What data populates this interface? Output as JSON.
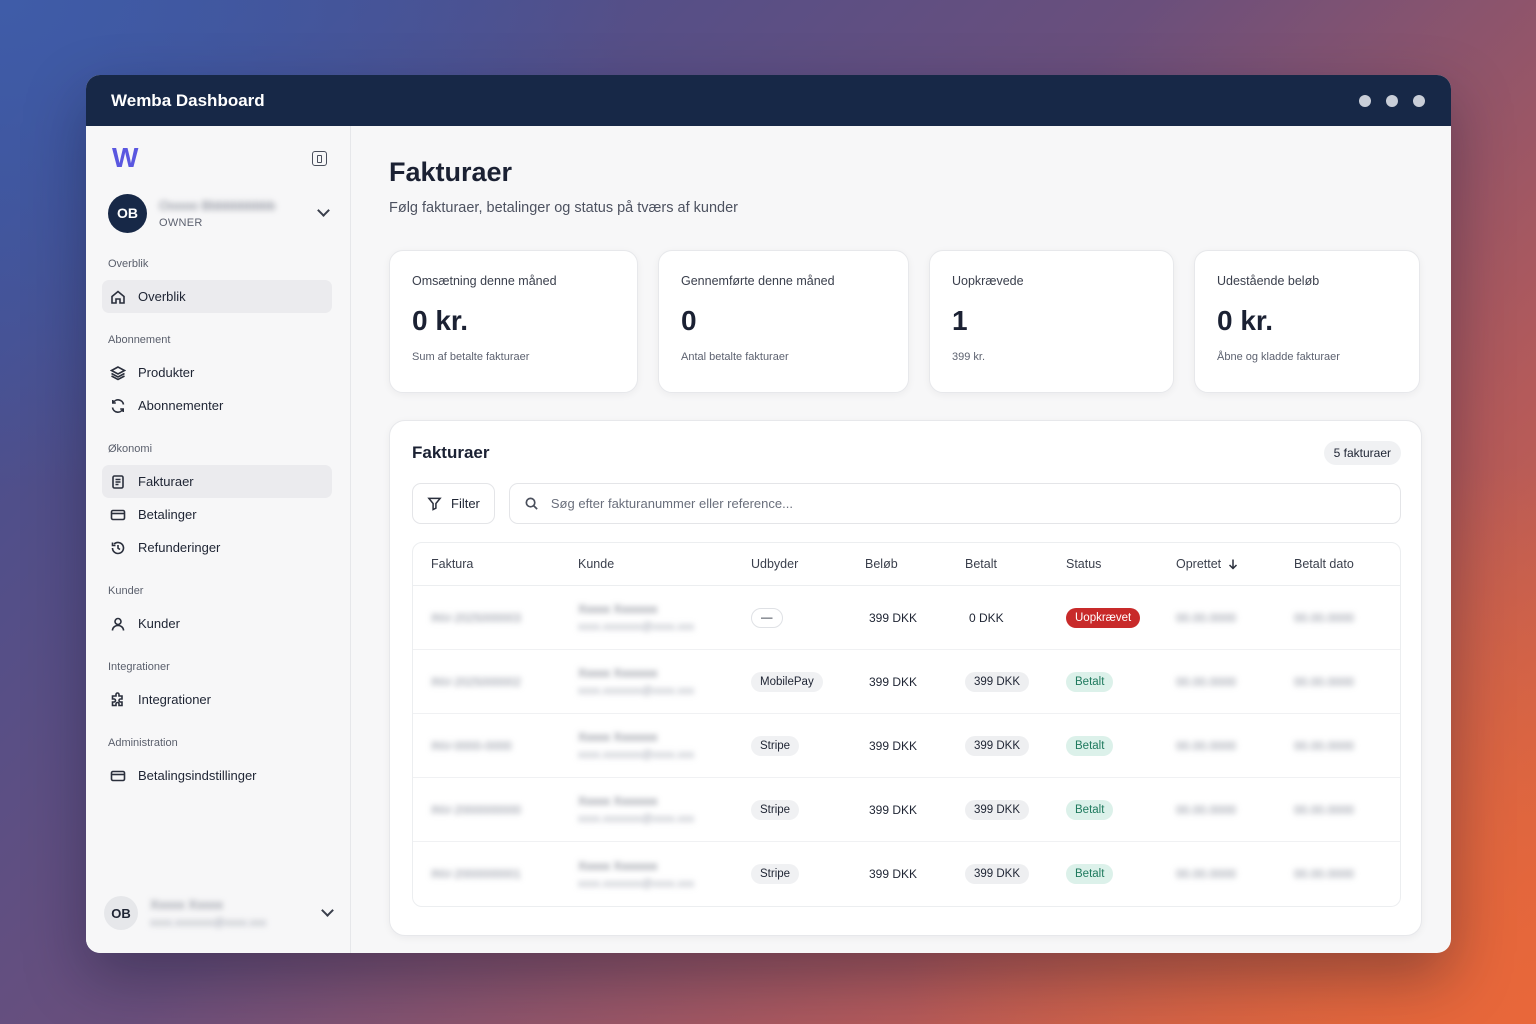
{
  "window": {
    "title": "Wemba Dashboard"
  },
  "sidebar": {
    "logo": "W",
    "user": {
      "initials": "OB",
      "name": "Ooooo Bbbbbbbbbb",
      "role": "OWNER"
    },
    "groups": [
      {
        "label": "Overblik",
        "items": [
          {
            "label": "Overblik",
            "icon": "home-icon"
          }
        ]
      },
      {
        "label": "Abonnement",
        "items": [
          {
            "label": "Produkter",
            "icon": "layers-icon"
          },
          {
            "label": "Abonnementer",
            "icon": "refresh-icon"
          }
        ]
      },
      {
        "label": "Økonomi",
        "items": [
          {
            "label": "Fakturaer",
            "icon": "invoice-icon"
          },
          {
            "label": "Betalinger",
            "icon": "card-icon"
          },
          {
            "label": "Refunderinger",
            "icon": "history-icon"
          }
        ]
      },
      {
        "label": "Kunder",
        "items": [
          {
            "label": "Kunder",
            "icon": "user-icon"
          }
        ]
      },
      {
        "label": "Integrationer",
        "items": [
          {
            "label": "Integrationer",
            "icon": "puzzle-icon"
          }
        ]
      },
      {
        "label": "Administration",
        "items": [
          {
            "label": "Betalingsindstillinger",
            "icon": "card-icon"
          }
        ]
      }
    ],
    "bottom_user": {
      "initials": "OB",
      "name": "Xxxxx Xxxxx",
      "email": "xxxx.xxxxxxx@xxxx.xxx"
    }
  },
  "page": {
    "title": "Fakturaer",
    "subtitle": "Følg fakturaer, betalinger og status på tværs af kunder"
  },
  "stats": [
    {
      "label": "Omsætning denne måned",
      "value": "0 kr.",
      "note": "Sum af betalte fakturaer"
    },
    {
      "label": "Gennemførte denne måned",
      "value": "0",
      "note": "Antal betalte fakturaer"
    },
    {
      "label": "Uopkrævede",
      "value": "1",
      "note": "399 kr."
    },
    {
      "label": "Udestående beløb",
      "value": "0 kr.",
      "note": "Åbne og kladde fakturaer"
    }
  ],
  "invoices": {
    "title": "Fakturaer",
    "count": "5 fakturaer",
    "filter_label": "Filter",
    "search_placeholder": "Søg efter fakturanummer eller reference...",
    "columns": [
      "Faktura",
      "Kunde",
      "Udbyder",
      "Beløb",
      "Betalt",
      "Status",
      "Oprettet",
      "Betalt dato"
    ],
    "rows": [
      {
        "faktura": "INV-2025000003",
        "kunde_name": "Xxxxx Xxxxxxx",
        "kunde_email": "xxxx.xxxxxxx@xxxx.xxx",
        "udbyder": "—",
        "belob": "399 DKK",
        "betalt": "0 DKK",
        "status": "Uopkrævet",
        "oprettet": "00.00.0000",
        "betalt_dato": "00.00.0000"
      },
      {
        "faktura": "INV-2025000002",
        "kunde_name": "Xxxxx Xxxxxxx",
        "kunde_email": "xxxx.xxxxxxx@xxxx.xxx",
        "udbyder": "MobilePay",
        "belob": "399 DKK",
        "betalt": "399 DKK",
        "status": "Betalt",
        "oprettet": "00.00.0000",
        "betalt_dato": "00.00.0000"
      },
      {
        "faktura": "INV-0000-0000",
        "kunde_name": "Xxxxx Xxxxxxx",
        "kunde_email": "xxxx.xxxxxxx@xxxx.xxx",
        "udbyder": "Stripe",
        "belob": "399 DKK",
        "betalt": "399 DKK",
        "status": "Betalt",
        "oprettet": "00.00.0000",
        "betalt_dato": "00.00.0000"
      },
      {
        "faktura": "INV-2000000000",
        "kunde_name": "Xxxxx Xxxxxxx",
        "kunde_email": "xxxx.xxxxxxx@xxxx.xxx",
        "udbyder": "Stripe",
        "belob": "399 DKK",
        "betalt": "399 DKK",
        "status": "Betalt",
        "oprettet": "00.00.0000",
        "betalt_dato": "00.00.0000"
      },
      {
        "faktura": "INV-2000000001",
        "kunde_name": "Xxxxx Xxxxxxx",
        "kunde_email": "xxxx.xxxxxxx@xxxx.xxx",
        "udbyder": "Stripe",
        "belob": "399 DKK",
        "betalt": "399 DKK",
        "status": "Betalt",
        "oprettet": "00.00.0000",
        "betalt_dato": "00.00.0000"
      }
    ]
  },
  "colors": {
    "titlebar": "#172847",
    "accent": "#5a57e0",
    "unpaid": "#c82a2a",
    "paid_bg": "#dcf1ea",
    "paid_text": "#1f7a5e"
  }
}
